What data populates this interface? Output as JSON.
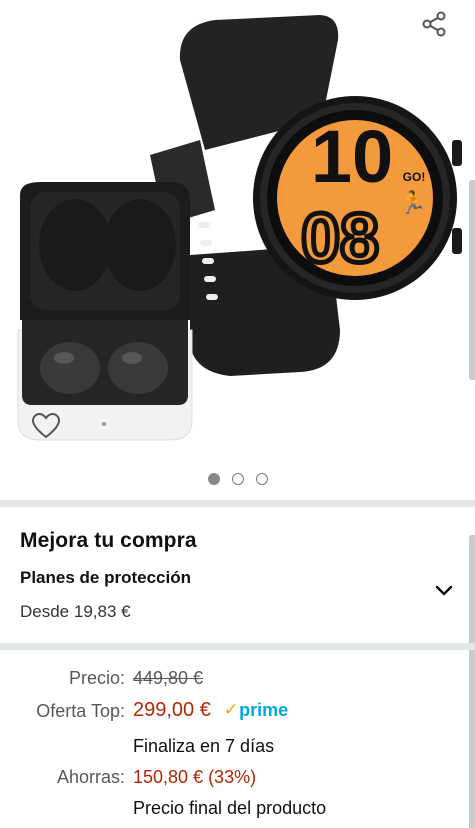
{
  "gallery": {
    "watch_face": {
      "hour": "10",
      "minute": "08",
      "badge": "GO!"
    },
    "dots": [
      {
        "active": true
      },
      {
        "active": false
      },
      {
        "active": false
      }
    ],
    "icons": {
      "share": "share-icon",
      "wishlist": "heart-icon"
    }
  },
  "upgrade": {
    "title": "Mejora tu compra",
    "plans_title": "Planes de protección",
    "plans_price": "Desde 19,83 €",
    "expand_icon": "chevron-down-icon"
  },
  "pricing": {
    "list_label": "Precio:",
    "list_price": "449,80 €",
    "deal_label": "Oferta Top:",
    "deal_price": "299,00 €",
    "prime_check": "✓",
    "prime_text": "prime",
    "ends_text": "Finaliza en 7 días",
    "savings_label": "Ahorras:",
    "savings_value": "150,80 € (33%)",
    "final_note": "Precio final del producto"
  },
  "colors": {
    "price_red": "#b12704",
    "prime_blue": "#00a8e1",
    "prime_orange": "#ff9900",
    "watch_face_orange": "#f39a3d",
    "divider": "#e3e6e6"
  }
}
